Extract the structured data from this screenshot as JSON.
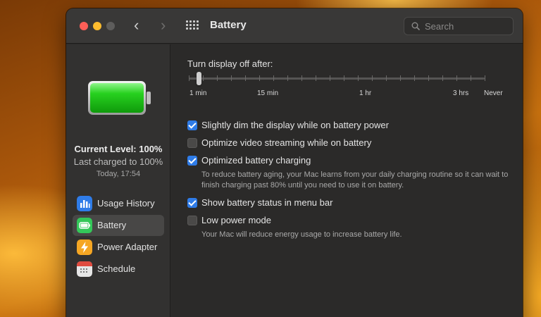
{
  "window": {
    "title": "Battery",
    "search_placeholder": "Search"
  },
  "sidebar": {
    "current_level": "Current Level: 100%",
    "last_charged": "Last charged to 100%",
    "timestamp": "Today, 17:54",
    "items": [
      {
        "label": "Usage History",
        "icon": "bar-chart-icon",
        "color": "#2f7ce8",
        "active": false
      },
      {
        "label": "Battery",
        "icon": "battery-icon",
        "color": "#34c759",
        "active": true
      },
      {
        "label": "Power Adapter",
        "icon": "lightning-icon",
        "color": "#f5a623",
        "active": false
      },
      {
        "label": "Schedule",
        "icon": "calendar-icon",
        "color": "#d8d8d8",
        "active": false
      }
    ]
  },
  "main": {
    "slider": {
      "title": "Turn display off after:",
      "labels": [
        "1 min",
        "15 min",
        "1 hr",
        "3 hrs",
        "Never"
      ],
      "value": "1 min"
    },
    "options": [
      {
        "label": "Slightly dim the display while on battery power",
        "checked": true
      },
      {
        "label": "Optimize video streaming while on battery",
        "checked": false
      },
      {
        "label": "Optimized battery charging",
        "checked": true,
        "description": "To reduce battery aging, your Mac learns from your daily charging routine so it can wait to finish charging past 80% until you need to use it on battery."
      },
      {
        "label": "Show battery status in menu bar",
        "checked": true
      },
      {
        "label": "Low power mode",
        "checked": false,
        "description": "Your Mac will reduce energy usage to increase battery life."
      }
    ]
  },
  "colors": {
    "accent": "#2f7ce8",
    "battery_green": "#22c41f"
  }
}
